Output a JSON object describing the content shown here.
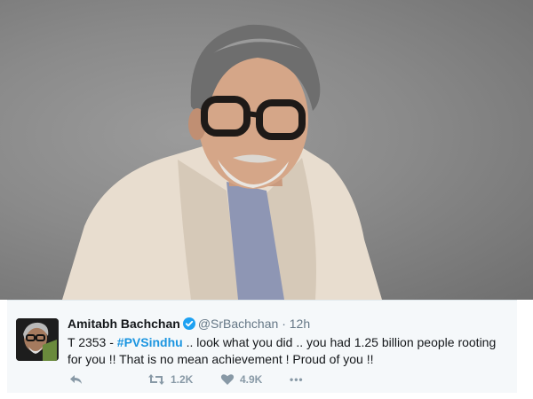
{
  "tweet": {
    "display_name": "Amitabh Bachchan",
    "handle": "@SrBachchan",
    "separator": "·",
    "time": "12h",
    "text_prefix": "T 2353 - ",
    "hashtag": "#PVSindhu",
    "text_suffix": " .. look what you did .. you had 1.25 billion people rooting for you !! That is no mean achievement ! Proud of you !!",
    "retweets": "1.2K",
    "likes": "4.9K",
    "more_glyph": "•••"
  },
  "icons": {
    "verified": "verified-badge-icon",
    "reply": "reply-icon",
    "retweet": "retweet-icon",
    "like": "heart-icon",
    "more": "more-icon"
  },
  "colors": {
    "hashtag": "#1b95e0",
    "verified": "#1da1f2",
    "card_background": "#f5f8fa",
    "muted": "#8899a6"
  }
}
